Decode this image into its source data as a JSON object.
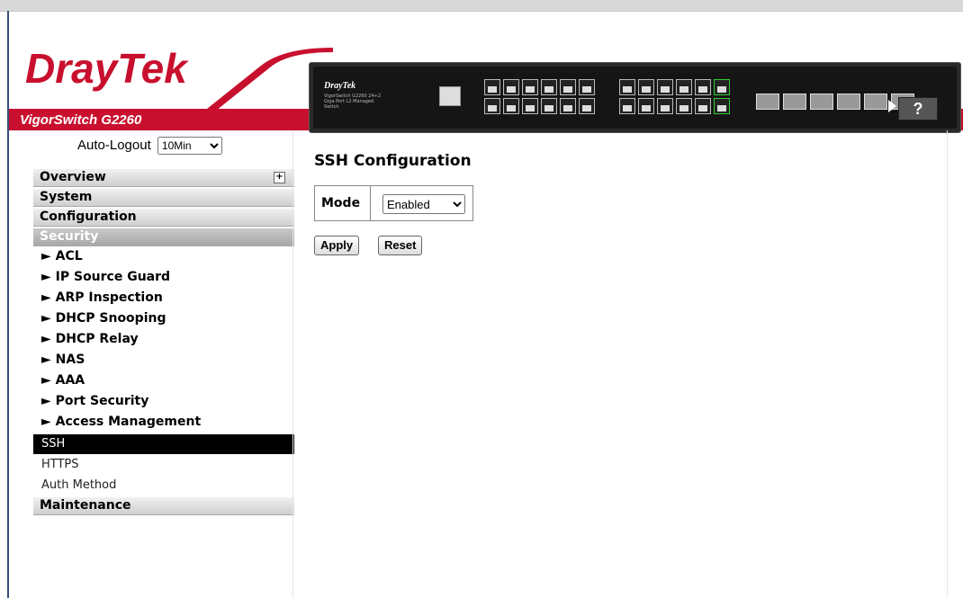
{
  "brand": {
    "logo": "DrayTek",
    "model": "VigorSwitch G2260",
    "panel_logo": "DrayTek",
    "panel_model": "VigorSwitch G2260\n24+2 Giga Port L2 Managed Switch",
    "accent": "#c8102e"
  },
  "header": {
    "help_label": "?"
  },
  "sidebar": {
    "autologout_label": "Auto-Logout",
    "autologout_value": "10Min",
    "groups": [
      "Overview",
      "System",
      "Configuration",
      "Security",
      "Maintenance"
    ],
    "security_items": [
      "► ACL",
      "► IP Source Guard",
      "► ARP Inspection",
      "► DHCP Snooping",
      "► DHCP Relay",
      "► NAS",
      "► AAA",
      "► Port Security",
      "► Access Management"
    ],
    "security_leaves": [
      "SSH",
      "HTTPS",
      "Auth Method"
    ],
    "selected": "SSH"
  },
  "main": {
    "title": "SSH Configuration",
    "mode_label": "Mode",
    "mode_value": "Enabled",
    "apply_label": "Apply",
    "reset_label": "Reset"
  }
}
